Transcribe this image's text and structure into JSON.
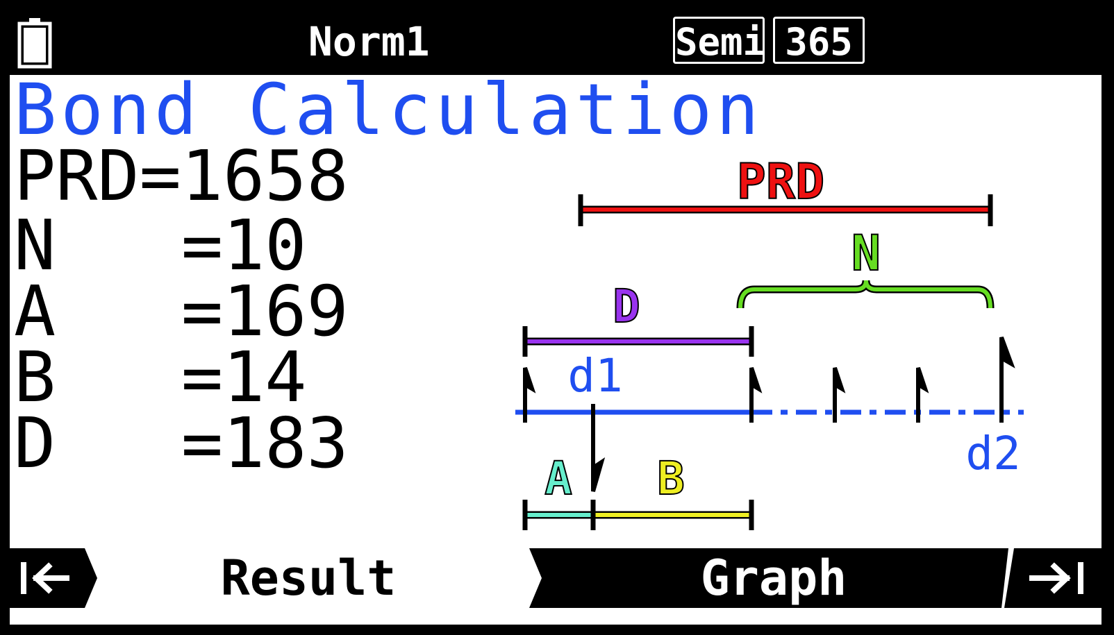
{
  "status_bar": {
    "angle_mode": "Norm1",
    "day_count_basis": "Semi",
    "year_days": "365",
    "battery_icon": "battery-icon"
  },
  "app": {
    "title": "Bond Calculation"
  },
  "results": [
    {
      "label": "PRD",
      "value": "1658"
    },
    {
      "label": "N",
      "value": "10"
    },
    {
      "label": "A",
      "value": "169"
    },
    {
      "label": "B",
      "value": "14"
    },
    {
      "label": "D",
      "value": "183"
    }
  ],
  "diagram": {
    "labels": {
      "prd": "PRD",
      "n": "N",
      "d": "D",
      "d1": "d1",
      "d2": "d2",
      "a": "A",
      "b": "B"
    },
    "colors": {
      "prd": "#ee1111",
      "n": "#66dd22",
      "d": "#9933ee",
      "timeline": "#1f4ef0",
      "a": "#66eecc",
      "b": "#eeee22",
      "arrow": "#000000"
    }
  },
  "function_bar": {
    "tab_result": "Result",
    "tab_graph": "Graph",
    "left_icon": "go-to-start-icon",
    "right_icon": "go-to-end-icon"
  }
}
